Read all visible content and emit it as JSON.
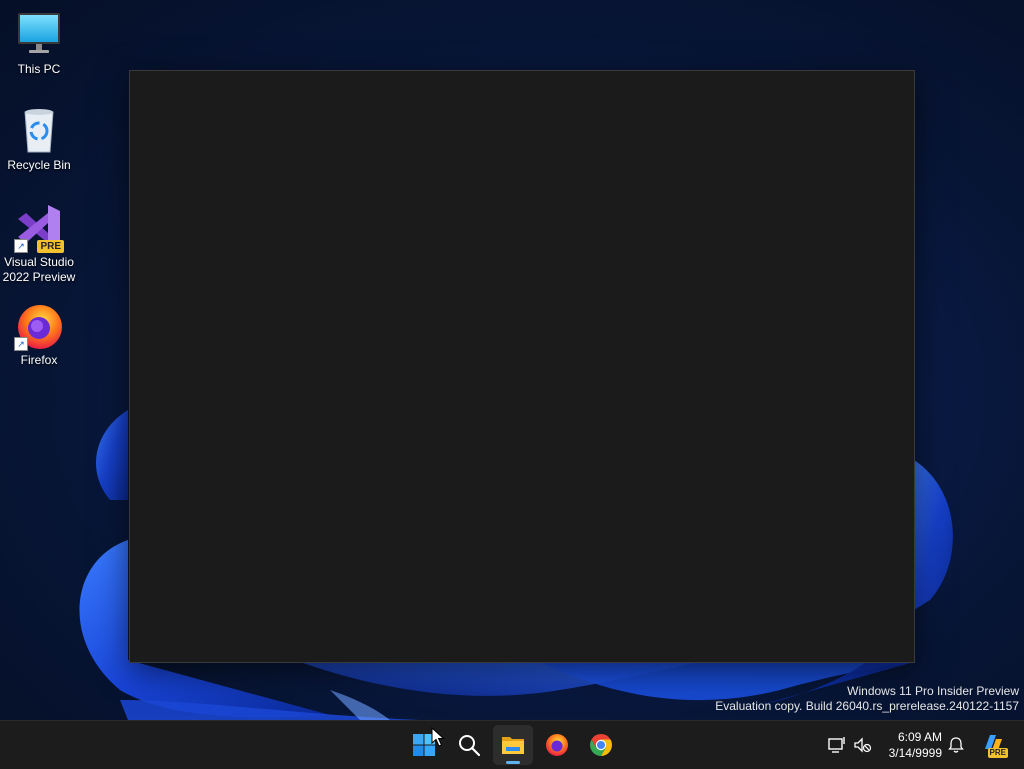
{
  "desktop": {
    "icons": [
      {
        "label": "This PC",
        "icon": "monitor-icon"
      },
      {
        "label": "Recycle Bin",
        "icon": "recycle-bin-icon"
      },
      {
        "label": "Visual Studio 2022 Preview",
        "line1": "Visual Studio",
        "line2": "2022 Preview",
        "badge": "PRE",
        "icon": "visual-studio-icon"
      },
      {
        "label": "Firefox",
        "icon": "firefox-icon"
      }
    ]
  },
  "window": {
    "content": ""
  },
  "watermark": {
    "line1": "Windows 11 Pro Insider Preview",
    "line2": "Evaluation copy. Build 26040.rs_prerelease.240122-1157"
  },
  "taskbar": {
    "apps": [
      {
        "name": "Start",
        "icon": "windows-start-icon"
      },
      {
        "name": "Search",
        "icon": "search-icon"
      },
      {
        "name": "File Explorer",
        "icon": "folder-icon",
        "active": true
      },
      {
        "name": "Firefox",
        "icon": "firefox-icon"
      },
      {
        "name": "Chrome",
        "icon": "chrome-icon"
      }
    ],
    "tray": {
      "time": "6:09 AM",
      "date": "3/14/9999",
      "copilot_badge": "PRE"
    }
  },
  "colors": {
    "taskbar_bg": "#1c1c1c",
    "window_bg": "#1b1b1b",
    "accent": "#5fb2f2"
  }
}
